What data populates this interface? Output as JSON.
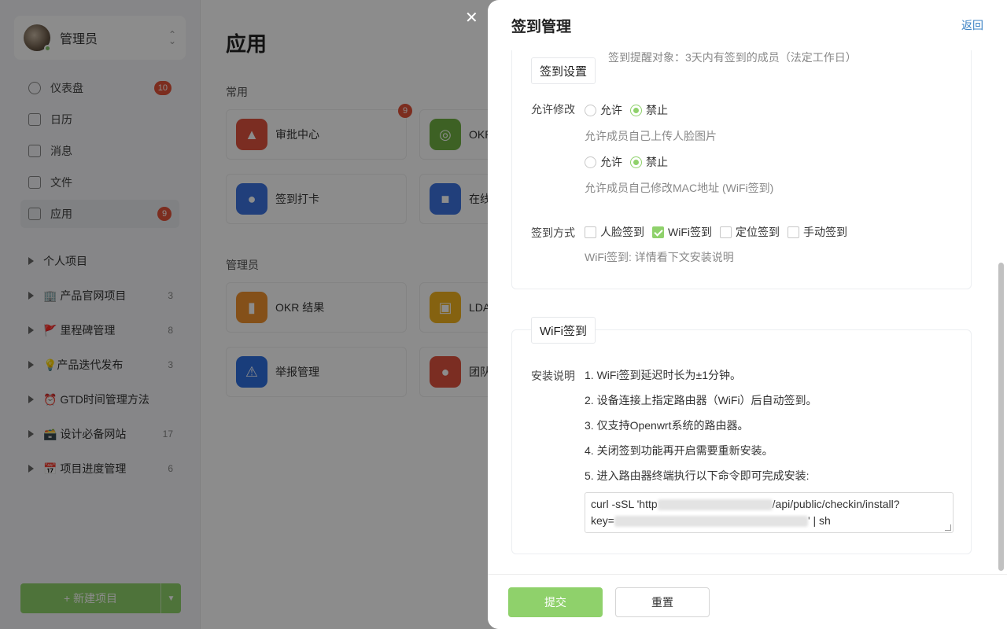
{
  "sidebar": {
    "user_name": "管理员",
    "menu": [
      {
        "label": "仪表盘",
        "badge": "10"
      },
      {
        "label": "日历",
        "badge": ""
      },
      {
        "label": "消息",
        "badge": ""
      },
      {
        "label": "文件",
        "badge": ""
      },
      {
        "label": "应用",
        "badge": "9"
      }
    ],
    "projects": [
      {
        "name": "个人项目",
        "count": ""
      },
      {
        "name": "🏢 产品官网项目",
        "count": "3"
      },
      {
        "name": "🚩 里程碑管理",
        "count": "8"
      },
      {
        "name": "💡产品迭代发布",
        "count": "3"
      },
      {
        "name": "⏰ GTD时间管理方法",
        "count": ""
      },
      {
        "name": "🗃️ 设计必备网站",
        "count": "17"
      },
      {
        "name": "📅 项目进度管理",
        "count": "6"
      }
    ],
    "new_project": "+ 新建项目"
  },
  "content": {
    "title": "应用",
    "section_common": "常用",
    "section_admin": "管理员",
    "common_apps": [
      {
        "name": "审批中心",
        "badge": "9",
        "color": "#e0533e",
        "icon": "stamp-icon"
      },
      {
        "name": "OKR",
        "badge": "",
        "color": "#6fb142",
        "icon": "target-icon"
      },
      {
        "name": "签到打卡",
        "badge": "",
        "color": "#3d74e0",
        "icon": "location-icon"
      },
      {
        "name": "在线",
        "badge": "",
        "color": "#3d74e0",
        "icon": "video-icon"
      }
    ],
    "admin_apps": [
      {
        "name": "OKR 结果",
        "badge": "",
        "color": "#f0932e",
        "icon": "chart-icon"
      },
      {
        "name": "LDA",
        "badge": "",
        "color": "#f2b21e",
        "icon": "contact-icon"
      },
      {
        "name": "举报管理",
        "badge": "",
        "color": "#2e6fe0",
        "icon": "warning-icon"
      },
      {
        "name": "团队",
        "badge": "",
        "color": "#e0533e",
        "icon": "team-icon"
      }
    ]
  },
  "drawer": {
    "title": "签到管理",
    "back": "返回",
    "settings": {
      "tag": "签到设置",
      "remind_text": "签到提醒对象：3天内有签到的成员（法定工作日）",
      "allow_edit_label": "允许修改",
      "opt_allow": "允许",
      "opt_forbid": "禁止",
      "face_hint": "允许成员自己上传人脸图片",
      "mac_hint": "允许成员自己修改MAC地址 (WiFi签到)",
      "method_label": "签到方式",
      "methods": [
        {
          "label": "人脸签到",
          "checked": false
        },
        {
          "label": "WiFi签到",
          "checked": true
        },
        {
          "label": "定位签到",
          "checked": false
        },
        {
          "label": "手动签到",
          "checked": false
        }
      ],
      "method_hint": "WiFi签到: 详情看下文安装说明"
    },
    "wifi": {
      "tag": "WiFi签到",
      "install_label": "安装说明",
      "steps": [
        "1. WiFi签到延迟时长为±1分钟。",
        "2. 设备连接上指定路由器（WiFi）后自动签到。",
        "3. 仅支持Openwrt系统的路由器。",
        "4. 关闭签到功能再开启需要重新安装。",
        "5. 进入路由器终端执行以下命令即可完成安装:"
      ],
      "cmd_line1_start": "curl -sSL 'http",
      "cmd_line1_end": "/api/public/checkin/install?",
      "cmd_line2_start": "key=",
      "cmd_line2_end": "' | sh"
    },
    "submit": "提交",
    "reset": "重置"
  }
}
